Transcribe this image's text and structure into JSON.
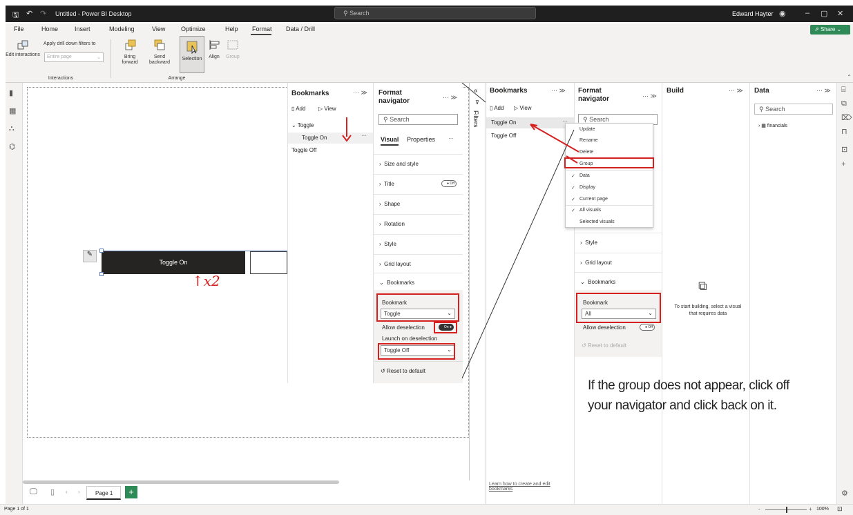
{
  "titlebar": {
    "title": "Untitled - Power BI Desktop",
    "search_placeholder": "Search",
    "user": "Edward Hayter"
  },
  "menu": [
    "File",
    "Home",
    "Insert",
    "Modeling",
    "View",
    "Optimize",
    "Help",
    "Format",
    "Data / Drill"
  ],
  "share_label": "Share",
  "ribbon": {
    "edit_interactions": "Edit interactions",
    "apply_drill": "Apply drill down filters to",
    "entire_page": "Entire page",
    "interactions_group": "Interactions",
    "bring_forward": "Bring forward",
    "send_backward": "Send backward",
    "selection": "Selection",
    "align": "Align",
    "group": "Group",
    "arrange_group": "Arrange"
  },
  "canvas": {
    "toggle_label": "Toggle On",
    "annotation": "↑x2"
  },
  "bookmarks_left": {
    "title": "Bookmarks",
    "add": "Add",
    "view": "View",
    "group": "Toggle",
    "items": [
      "Toggle On",
      "Toggle Off"
    ]
  },
  "format_left": {
    "title": "Format navigator",
    "search": "Search",
    "tab_visual": "Visual",
    "tab_properties": "Properties",
    "sections": [
      "Size and style",
      "Title",
      "Shape",
      "Rotation",
      "Style",
      "Grid layout",
      "Bookmarks"
    ],
    "title_toggle": "Off",
    "bookmark_label": "Bookmark",
    "bookmark_value": "Toggle",
    "allow_deselection": "Allow deselection",
    "allow_toggle": "On",
    "launch_label": "Launch on deselection",
    "launch_value": "Toggle Off",
    "reset": "Reset to default"
  },
  "filters_label": "Filters",
  "bookmarks_right": {
    "title": "Bookmarks",
    "add": "Add",
    "view": "View",
    "items": [
      "Toggle On",
      "Toggle Off"
    ],
    "learn": "Learn how to create and edit bookmarks"
  },
  "context_menu": [
    {
      "label": "Update",
      "check": ""
    },
    {
      "label": "Rename",
      "check": ""
    },
    {
      "label": "Delete",
      "check": ""
    },
    {
      "label": "Group",
      "check": ""
    },
    {
      "label": "Data",
      "check": "✓"
    },
    {
      "label": "Display",
      "check": "✓"
    },
    {
      "label": "Current page",
      "check": "✓"
    },
    {
      "label": "All visuals",
      "check": "✓"
    },
    {
      "label": "Selected visuals",
      "check": ""
    }
  ],
  "format_right": {
    "title": "Format navigator",
    "search": "Search",
    "style": "Style",
    "grid": "Grid layout",
    "bookmarks": "Bookmarks",
    "bookmark_label": "Bookmark",
    "bookmark_value": "All",
    "allow_deselection": "Allow deselection",
    "allow_toggle": "Off",
    "reset": "Reset to default"
  },
  "build": {
    "title": "Build",
    "hint": "To start building, select a visual that requires data"
  },
  "data": {
    "title": "Data",
    "search": "Search",
    "table": "financials"
  },
  "note": "If the group does not appear, click off your navigator and click back on it.",
  "pages": {
    "page1": "Page 1"
  },
  "status": {
    "page_count": "Page 1 of 1",
    "zoom": "100%"
  }
}
